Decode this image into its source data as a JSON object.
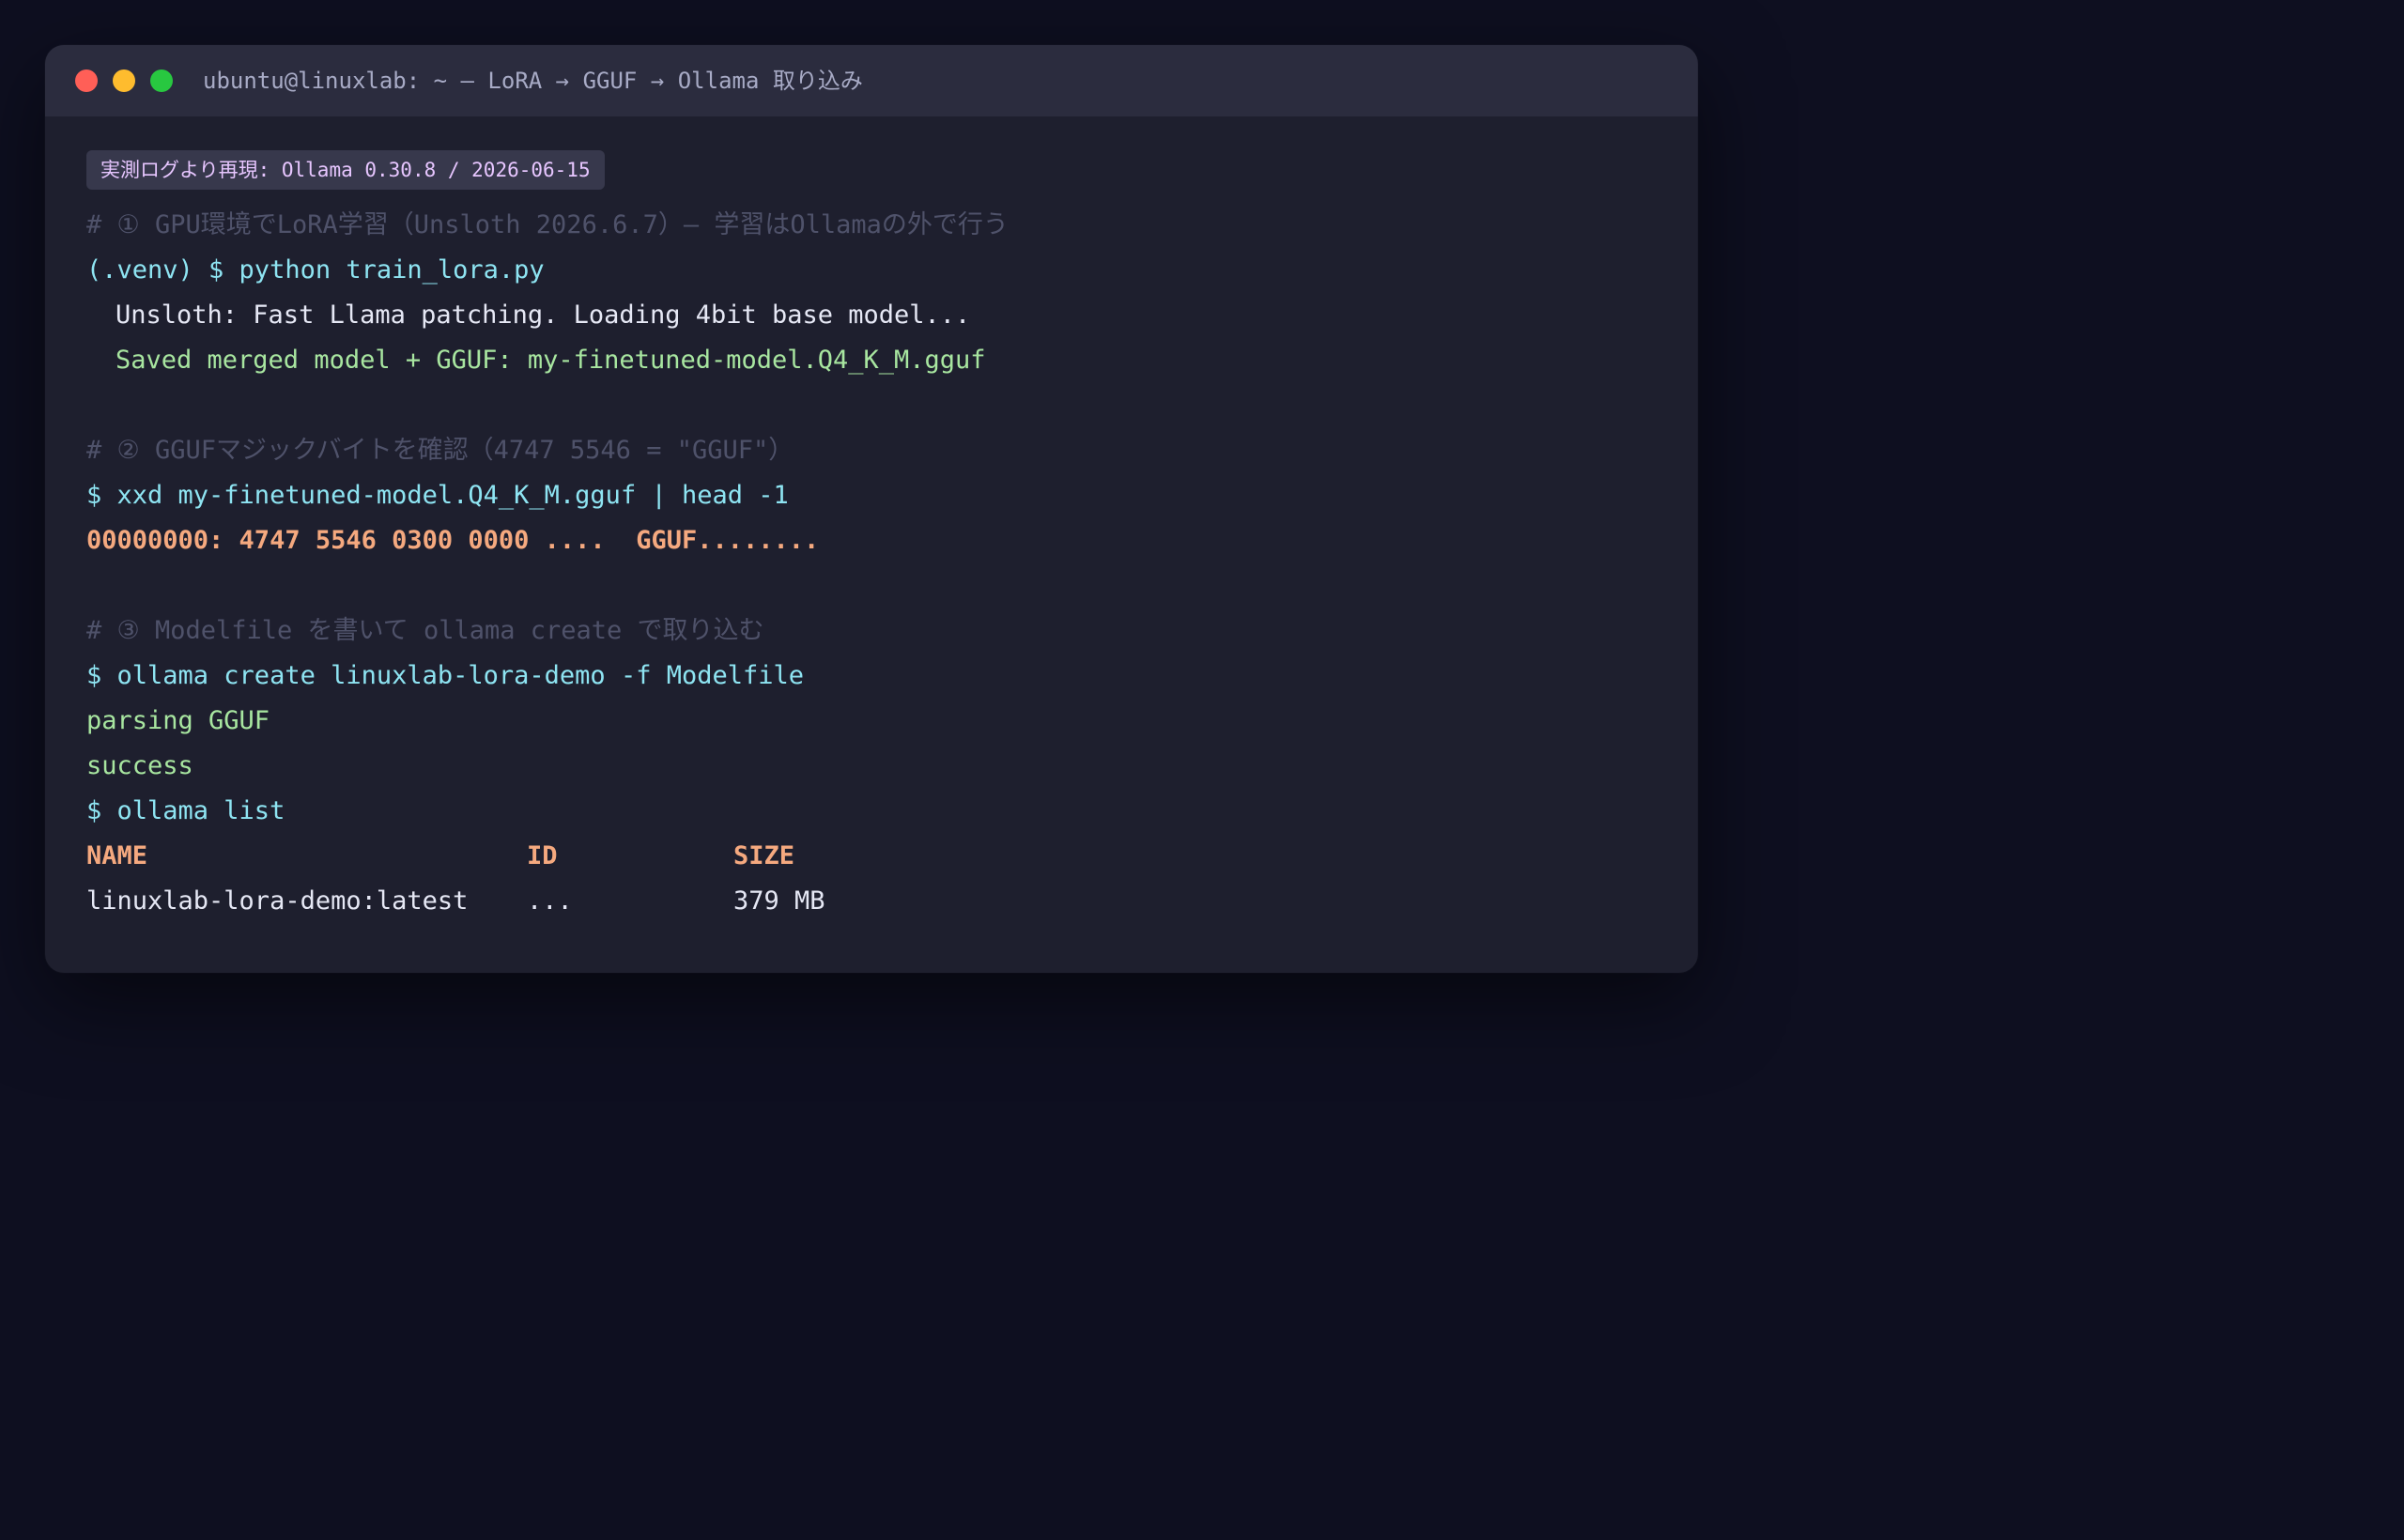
{
  "window": {
    "title": "ubuntu@linuxlab: ~ — LoRA → GGUF → Ollama 取り込み"
  },
  "badge": "実測ログより再現: Ollama 0.30.8 / 2026-06-15",
  "section1": {
    "comment": "# ① GPU環境でLoRA学習（Unsloth 2026.6.7）— 学習はOllamaの外で行う",
    "command": "(.venv) $ python train_lora.py",
    "output1": "Unsloth: Fast Llama patching. Loading 4bit base model...",
    "output2": "Saved merged model + GGUF: my-finetuned-model.Q4_K_M.gguf"
  },
  "section2": {
    "comment": "# ② GGUFマジックバイトを確認（4747 5546 = \"GGUF\"）",
    "command": "$ xxd my-finetuned-model.Q4_K_M.gguf | head -1",
    "output": "00000000: 4747 5546 0300 0000 ....  GGUF........"
  },
  "section3": {
    "comment": "# ③ Modelfile を書いて ollama create で取り込む",
    "command1": "$ ollama create linuxlab-lora-demo -f Modelfile",
    "output1": "parsing GGUF",
    "output2": "success",
    "command2": "$ ollama list"
  },
  "model_table": {
    "headers": [
      "NAME",
      "ID",
      "SIZE"
    ],
    "rows": [
      [
        "linuxlab-lora-demo:latest",
        "...",
        "379 MB"
      ]
    ]
  },
  "colors": {
    "background": "#0e0f20",
    "window": "#1e1f2e",
    "titlebar": "#2b2c3e",
    "comment": "#4f526a",
    "command": "#8ee4f2",
    "success": "#a8e6a0",
    "highlight": "#f5a97f",
    "badge_text": "#e7c6ff"
  }
}
